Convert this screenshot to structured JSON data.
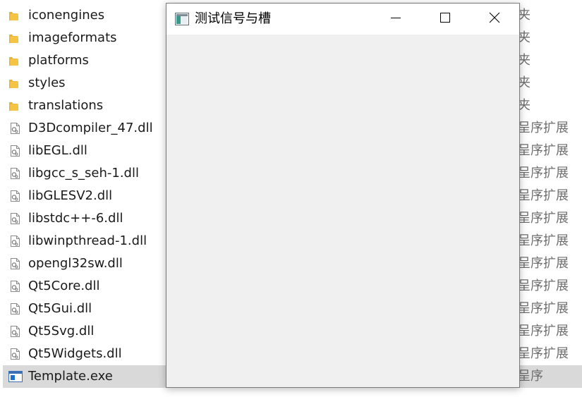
{
  "explorer": {
    "files": [
      {
        "name": "iconengines",
        "type": "夹",
        "icon": "folder-icon"
      },
      {
        "name": "imageformats",
        "type": "夹",
        "icon": "folder-icon"
      },
      {
        "name": "platforms",
        "type": "夹",
        "icon": "folder-icon"
      },
      {
        "name": "styles",
        "type": "夹",
        "icon": "folder-icon"
      },
      {
        "name": "translations",
        "type": "夹",
        "icon": "folder-icon"
      },
      {
        "name": "D3Dcompiler_47.dll",
        "type": "呈序扩展",
        "icon": "dll-icon"
      },
      {
        "name": "libEGL.dll",
        "type": "呈序扩展",
        "icon": "dll-icon"
      },
      {
        "name": "libgcc_s_seh-1.dll",
        "type": "呈序扩展",
        "icon": "dll-icon"
      },
      {
        "name": "libGLESV2.dll",
        "type": "呈序扩展",
        "icon": "dll-icon"
      },
      {
        "name": "libstdc++-6.dll",
        "type": "呈序扩展",
        "icon": "dll-icon"
      },
      {
        "name": "libwinpthread-1.dll",
        "type": "呈序扩展",
        "icon": "dll-icon"
      },
      {
        "name": "opengl32sw.dll",
        "type": "呈序扩展",
        "icon": "dll-icon"
      },
      {
        "name": "Qt5Core.dll",
        "type": "呈序扩展",
        "icon": "dll-icon"
      },
      {
        "name": "Qt5Gui.dll",
        "type": "呈序扩展",
        "icon": "dll-icon"
      },
      {
        "name": "Qt5Svg.dll",
        "type": "呈序扩展",
        "icon": "dll-icon"
      },
      {
        "name": "Qt5Widgets.dll",
        "type": "呈序扩展",
        "icon": "dll-icon"
      },
      {
        "name": "Template.exe",
        "type": "呈序",
        "icon": "exe-icon",
        "selected": true
      }
    ]
  },
  "window": {
    "title": "测试信号与槽",
    "icon": "app-window-icon",
    "controls": {
      "minimize": "minimize-icon",
      "maximize": "maximize-icon",
      "close": "close-icon"
    }
  },
  "colors": {
    "folder": "#f6c445",
    "selection": "#d9d9d9",
    "client_bg": "#f0f0f0",
    "exe_blue": "#1e6fd0"
  }
}
